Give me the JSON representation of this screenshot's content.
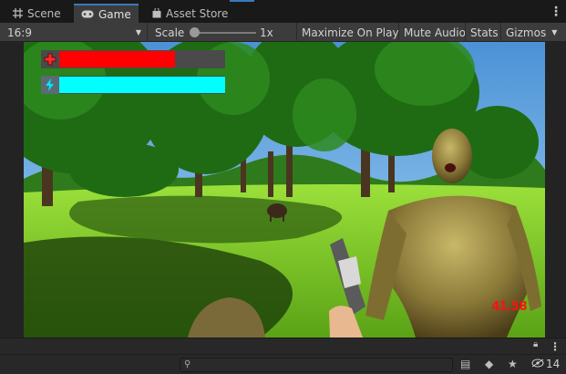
{
  "tabs": [
    {
      "label": "Scene",
      "icon": "grid-icon",
      "active": false
    },
    {
      "label": "Game",
      "icon": "gamepad-icon",
      "active": true
    },
    {
      "label": "Asset Store",
      "icon": "shopping-bag-icon",
      "active": false
    }
  ],
  "toolbar": {
    "aspect": "16:9",
    "scale_label": "Scale",
    "scale_value": "1x",
    "maximize": "Maximize On Play",
    "mute": "Mute Audio",
    "stats": "Stats",
    "gizmos": "Gizmos"
  },
  "hud": {
    "health_fraction": 0.7,
    "stamina_fraction": 1.0,
    "timer": "41.58",
    "health_color": "#ff0000",
    "stamina_color": "#00ffff"
  },
  "bottom": {
    "search_placeholder": "",
    "hidden_count": "14"
  },
  "colors": {
    "accent": "#3a79bb",
    "sky": "#58a8e8",
    "grass": "#7cd02a"
  }
}
